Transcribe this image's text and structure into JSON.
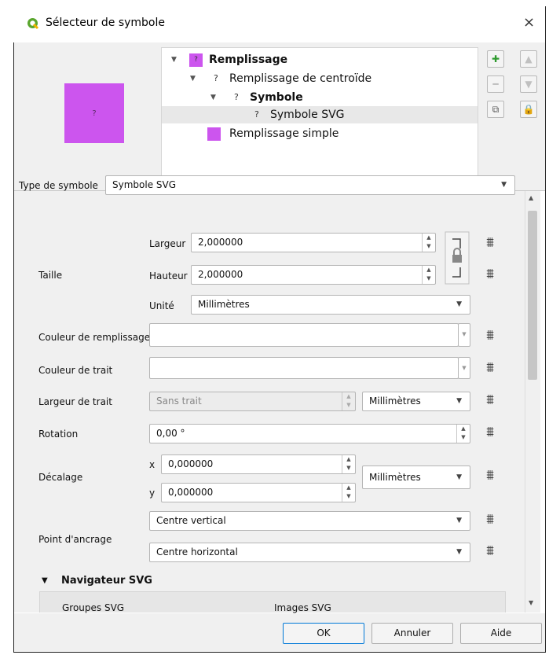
{
  "window": {
    "title": "Sélecteur de symbole",
    "close": "×"
  },
  "preview": {
    "glyph": "?",
    "color": "#cc55ee"
  },
  "tree": {
    "items": [
      {
        "label": "Remplissage",
        "marker": "?",
        "bold": true,
        "expanded": true
      },
      {
        "label": "Remplissage de centroïde",
        "marker": "?",
        "bold": false,
        "expanded": true
      },
      {
        "label": "Symbole",
        "marker": "?",
        "bold": true,
        "expanded": true
      },
      {
        "label": "Symbole SVG",
        "marker": "?",
        "bold": false,
        "selected": true
      },
      {
        "label": "Remplissage simple",
        "marker": "",
        "bold": false
      }
    ]
  },
  "side_buttons": {
    "add": "✚",
    "remove": "━",
    "up": "▲",
    "down": "▼",
    "duplicate": "⧉",
    "lock": "🔒"
  },
  "symbol_type": {
    "label": "Type de symbole",
    "value": "Symbole SVG"
  },
  "size": {
    "label": "Taille",
    "width_label": "Largeur",
    "width_value": "2,000000",
    "height_label": "Hauteur",
    "height_value": "2,000000",
    "unit_label": "Unité",
    "unit_value": "Millimètres"
  },
  "fill_color": {
    "label": "Couleur de remplissage",
    "value": ""
  },
  "stroke_color": {
    "label": "Couleur de trait",
    "value": ""
  },
  "stroke_width": {
    "label": "Largeur de trait",
    "value": "Sans trait",
    "unit": "Millimètres"
  },
  "rotation": {
    "label": "Rotation",
    "value": "0,00 °"
  },
  "offset": {
    "label": "Décalage",
    "x_label": "x",
    "x_value": "0,000000",
    "y_label": "y",
    "y_value": "0,000000",
    "unit": "Millimètres"
  },
  "anchor": {
    "label": "Point d'ancrage",
    "vertical": "Centre vertical",
    "horizontal": "Centre horizontal"
  },
  "svg_browser": {
    "title": "Navigateur SVG",
    "groups": "Groupes SVG",
    "images": "Images SVG"
  },
  "buttons": {
    "ok": "OK",
    "cancel": "Annuler",
    "help": "Aide"
  },
  "icons": {
    "expression": "⩩",
    "arrow_down": "▼",
    "spin_up": "▲",
    "spin_down": "▼"
  }
}
